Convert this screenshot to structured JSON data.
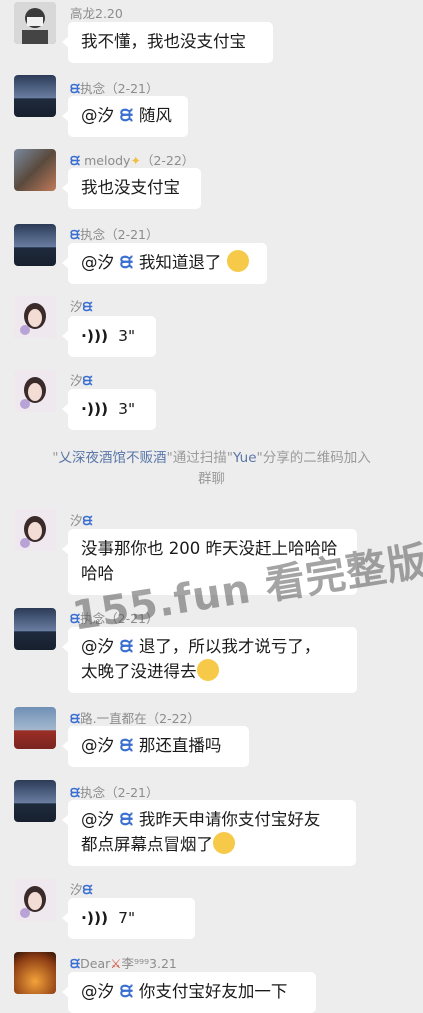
{
  "messages": [
    {
      "sender": "高龙2.20",
      "text": "我不懂，我也没支付宝",
      "avatar": "masked-person"
    },
    {
      "sender": "执念（2-21）",
      "mention": "@汐",
      "text": "随风",
      "avatar": "lake-dusk"
    },
    {
      "sender": "melody",
      "date": "（2-22）",
      "text": "我也没支付宝",
      "avatar": "street-scene"
    },
    {
      "sender": "执念（2-21）",
      "mention": "@汐",
      "text": "我知道退了",
      "avatar": "lake-dusk"
    },
    {
      "sender": "汐",
      "voice": "3\"",
      "avatar": "girl-portrait"
    },
    {
      "sender": "汐",
      "voice": "3\"",
      "avatar": "girl-portrait"
    },
    {
      "sender": "汐",
      "text1": "没事那你也 200 昨天没赶上哈哈哈",
      "text2": "哈哈",
      "avatar": "girl-portrait"
    },
    {
      "sender": "执念（2-21）",
      "mention": "@汐",
      "text1": "退了，所以我才说亏了，",
      "text2": "太晚了没进得去",
      "avatar": "lake-dusk"
    },
    {
      "sender": "路.一直都在（2-22）",
      "mention": "@汐",
      "text": "那还直播吗",
      "avatar": "tiananmen"
    },
    {
      "sender": "执念（2-21）",
      "mention": "@汐",
      "text1": "我昨天申请你支付宝好友",
      "text2": "都点屏幕点冒烟了",
      "avatar": "lake-dusk"
    },
    {
      "sender": "汐",
      "voice": "7\"",
      "avatar": "girl-portrait"
    },
    {
      "sender": "Dear",
      "sender_suffix": "李⁹⁹⁹3.21",
      "mention": "@汐",
      "text": "你支付宝好友加一下",
      "avatar": "fire"
    }
  ],
  "system_notice": {
    "q1": "\"",
    "name": "乂深夜酒馆不贩酒",
    "q2": "\"",
    "mid": "通过扫描\"",
    "inviter": "Yue",
    "tail": "\"分享的二维码加入",
    "line2": "群聊"
  },
  "watermark": "155.fun 看完整版",
  "colors": {
    "background": "#ededed",
    "bubble": "#ffffff",
    "name_text": "#8c8c8c",
    "link_blue": "#5a77a8"
  }
}
